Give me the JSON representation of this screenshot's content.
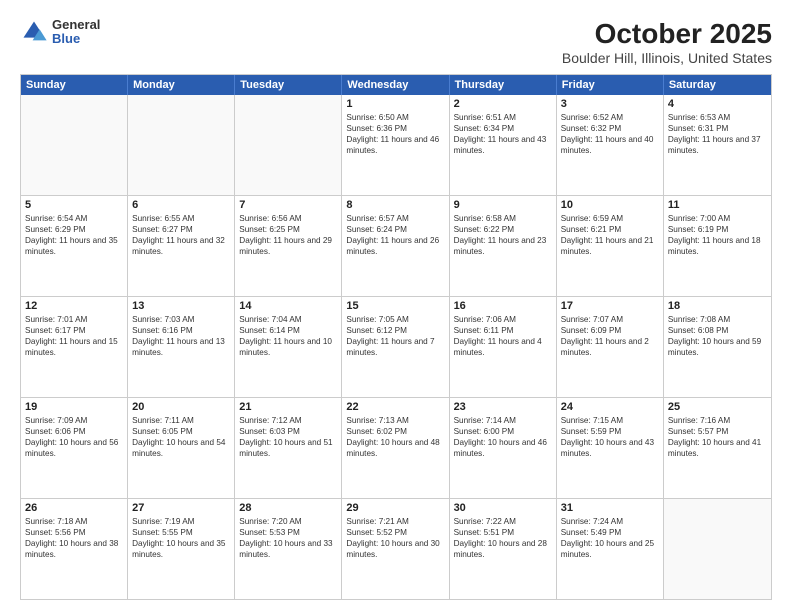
{
  "header": {
    "logo": {
      "general": "General",
      "blue": "Blue"
    },
    "title": "October 2025",
    "location": "Boulder Hill, Illinois, United States"
  },
  "days_of_week": [
    "Sunday",
    "Monday",
    "Tuesday",
    "Wednesday",
    "Thursday",
    "Friday",
    "Saturday"
  ],
  "weeks": [
    [
      {
        "day": "",
        "empty": true
      },
      {
        "day": "",
        "empty": true
      },
      {
        "day": "",
        "empty": true
      },
      {
        "day": "1",
        "sunrise": "6:50 AM",
        "sunset": "6:36 PM",
        "daylight": "11 hours and 46 minutes."
      },
      {
        "day": "2",
        "sunrise": "6:51 AM",
        "sunset": "6:34 PM",
        "daylight": "11 hours and 43 minutes."
      },
      {
        "day": "3",
        "sunrise": "6:52 AM",
        "sunset": "6:32 PM",
        "daylight": "11 hours and 40 minutes."
      },
      {
        "day": "4",
        "sunrise": "6:53 AM",
        "sunset": "6:31 PM",
        "daylight": "11 hours and 37 minutes."
      }
    ],
    [
      {
        "day": "5",
        "sunrise": "6:54 AM",
        "sunset": "6:29 PM",
        "daylight": "11 hours and 35 minutes."
      },
      {
        "day": "6",
        "sunrise": "6:55 AM",
        "sunset": "6:27 PM",
        "daylight": "11 hours and 32 minutes."
      },
      {
        "day": "7",
        "sunrise": "6:56 AM",
        "sunset": "6:25 PM",
        "daylight": "11 hours and 29 minutes."
      },
      {
        "day": "8",
        "sunrise": "6:57 AM",
        "sunset": "6:24 PM",
        "daylight": "11 hours and 26 minutes."
      },
      {
        "day": "9",
        "sunrise": "6:58 AM",
        "sunset": "6:22 PM",
        "daylight": "11 hours and 23 minutes."
      },
      {
        "day": "10",
        "sunrise": "6:59 AM",
        "sunset": "6:21 PM",
        "daylight": "11 hours and 21 minutes."
      },
      {
        "day": "11",
        "sunrise": "7:00 AM",
        "sunset": "6:19 PM",
        "daylight": "11 hours and 18 minutes."
      }
    ],
    [
      {
        "day": "12",
        "sunrise": "7:01 AM",
        "sunset": "6:17 PM",
        "daylight": "11 hours and 15 minutes."
      },
      {
        "day": "13",
        "sunrise": "7:03 AM",
        "sunset": "6:16 PM",
        "daylight": "11 hours and 13 minutes."
      },
      {
        "day": "14",
        "sunrise": "7:04 AM",
        "sunset": "6:14 PM",
        "daylight": "11 hours and 10 minutes."
      },
      {
        "day": "15",
        "sunrise": "7:05 AM",
        "sunset": "6:12 PM",
        "daylight": "11 hours and 7 minutes."
      },
      {
        "day": "16",
        "sunrise": "7:06 AM",
        "sunset": "6:11 PM",
        "daylight": "11 hours and 4 minutes."
      },
      {
        "day": "17",
        "sunrise": "7:07 AM",
        "sunset": "6:09 PM",
        "daylight": "11 hours and 2 minutes."
      },
      {
        "day": "18",
        "sunrise": "7:08 AM",
        "sunset": "6:08 PM",
        "daylight": "10 hours and 59 minutes."
      }
    ],
    [
      {
        "day": "19",
        "sunrise": "7:09 AM",
        "sunset": "6:06 PM",
        "daylight": "10 hours and 56 minutes."
      },
      {
        "day": "20",
        "sunrise": "7:11 AM",
        "sunset": "6:05 PM",
        "daylight": "10 hours and 54 minutes."
      },
      {
        "day": "21",
        "sunrise": "7:12 AM",
        "sunset": "6:03 PM",
        "daylight": "10 hours and 51 minutes."
      },
      {
        "day": "22",
        "sunrise": "7:13 AM",
        "sunset": "6:02 PM",
        "daylight": "10 hours and 48 minutes."
      },
      {
        "day": "23",
        "sunrise": "7:14 AM",
        "sunset": "6:00 PM",
        "daylight": "10 hours and 46 minutes."
      },
      {
        "day": "24",
        "sunrise": "7:15 AM",
        "sunset": "5:59 PM",
        "daylight": "10 hours and 43 minutes."
      },
      {
        "day": "25",
        "sunrise": "7:16 AM",
        "sunset": "5:57 PM",
        "daylight": "10 hours and 41 minutes."
      }
    ],
    [
      {
        "day": "26",
        "sunrise": "7:18 AM",
        "sunset": "5:56 PM",
        "daylight": "10 hours and 38 minutes."
      },
      {
        "day": "27",
        "sunrise": "7:19 AM",
        "sunset": "5:55 PM",
        "daylight": "10 hours and 35 minutes."
      },
      {
        "day": "28",
        "sunrise": "7:20 AM",
        "sunset": "5:53 PM",
        "daylight": "10 hours and 33 minutes."
      },
      {
        "day": "29",
        "sunrise": "7:21 AM",
        "sunset": "5:52 PM",
        "daylight": "10 hours and 30 minutes."
      },
      {
        "day": "30",
        "sunrise": "7:22 AM",
        "sunset": "5:51 PM",
        "daylight": "10 hours and 28 minutes."
      },
      {
        "day": "31",
        "sunrise": "7:24 AM",
        "sunset": "5:49 PM",
        "daylight": "10 hours and 25 minutes."
      },
      {
        "day": "",
        "empty": true
      }
    ]
  ]
}
